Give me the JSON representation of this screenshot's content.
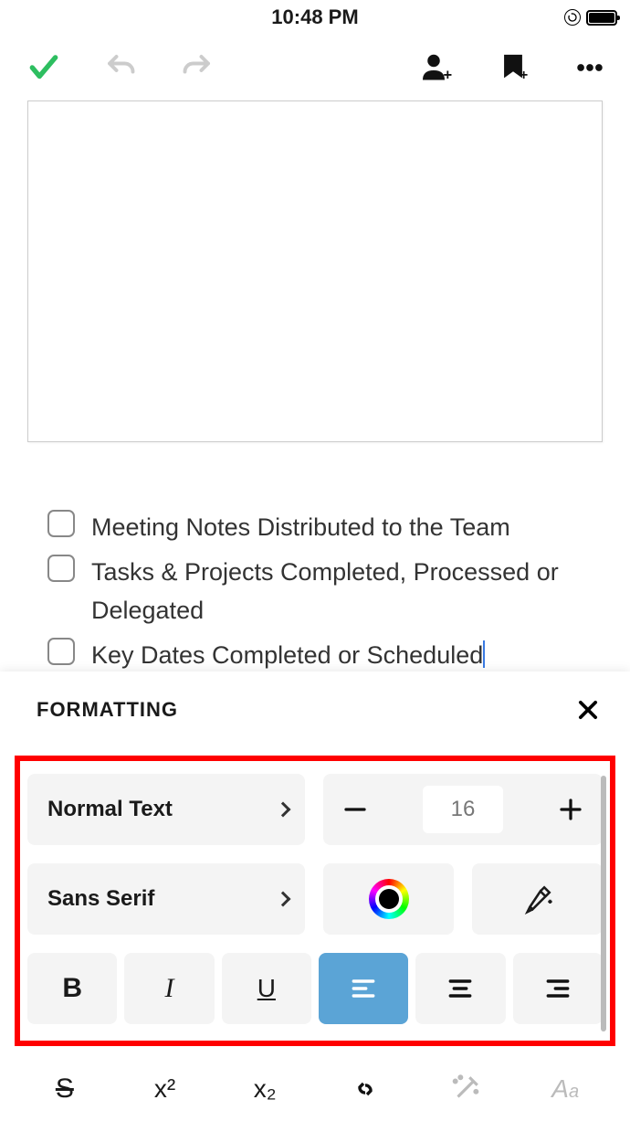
{
  "status": {
    "time": "10:48 PM"
  },
  "checklist": {
    "items": [
      {
        "text": "Meeting Notes Distributed to the Team",
        "checked": false
      },
      {
        "text": "Tasks & Projects Completed, Processed or Delegated",
        "checked": false
      },
      {
        "text": "Key Dates Completed or Scheduled",
        "checked": false
      }
    ]
  },
  "formatting": {
    "title": "FORMATTING",
    "text_style": "Normal Text",
    "font_family": "Sans Serif",
    "font_size": "16",
    "buttons": {
      "bold": "B",
      "italic": "I",
      "underline": "U",
      "strike": "S",
      "superscript": "x²",
      "subscript": "x₂"
    },
    "alignment_active": "left"
  }
}
